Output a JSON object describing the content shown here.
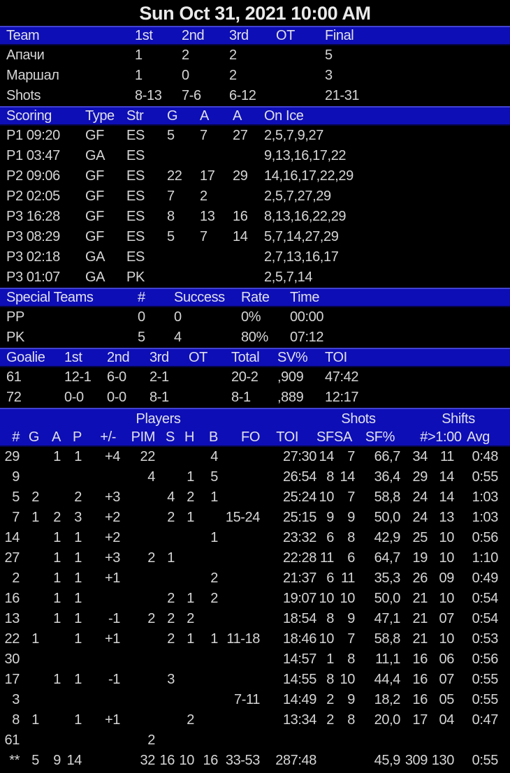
{
  "title": "Sun Oct 31, 2021 10:00 AM",
  "colors": {
    "background": "#000000",
    "header_bar": "#0e0eb6",
    "header_edge_light": "#4242d2",
    "header_edge_dark": "#050548",
    "text": "#d5d5d5",
    "header_text": "#dfe0ec"
  },
  "team_table": {
    "headers": [
      "Team",
      "1st",
      "2nd",
      "3rd",
      "OT",
      "Final"
    ],
    "rows": [
      [
        "Апачи",
        "1",
        "2",
        "2",
        "",
        "5"
      ],
      [
        "Маршал",
        "1",
        "0",
        "2",
        "",
        "3"
      ],
      [
        "Shots",
        "8-13",
        "7-6",
        "6-12",
        "",
        "21-31"
      ]
    ]
  },
  "scoring_table": {
    "headers": [
      "Scoring",
      "Type",
      "Str",
      "G",
      "A",
      "A",
      "On Ice"
    ],
    "rows": [
      [
        "P1 09:20",
        "GF",
        "ES",
        "5",
        "7",
        "27",
        "2,5,7,9,27"
      ],
      [
        "P1 03:47",
        "GA",
        "ES",
        "",
        "",
        "",
        "9,13,16,17,22"
      ],
      [
        "P2 09:06",
        "GF",
        "ES",
        "22",
        "17",
        "29",
        "14,16,17,22,29"
      ],
      [
        "P2 02:05",
        "GF",
        "ES",
        "7",
        "2",
        "",
        "2,5,7,27,29"
      ],
      [
        "P3 16:28",
        "GF",
        "ES",
        "8",
        "13",
        "16",
        "8,13,16,22,29"
      ],
      [
        "P3 08:29",
        "GF",
        "ES",
        "5",
        "7",
        "14",
        "5,7,14,27,29"
      ],
      [
        "P3 02:18",
        "GA",
        "ES",
        "",
        "",
        "",
        "2,7,13,16,17"
      ],
      [
        "P3 01:07",
        "GA",
        "PK",
        "",
        "",
        "",
        "2,5,7,14"
      ]
    ]
  },
  "special_teams_table": {
    "headers": [
      "Special Teams",
      "#",
      "Success",
      "Rate",
      "Time"
    ],
    "rows": [
      [
        "PP",
        "0",
        "0",
        "0%",
        "00:00"
      ],
      [
        "PK",
        "5",
        "4",
        "80%",
        "07:12"
      ]
    ]
  },
  "goalie_table": {
    "headers": [
      "Goalie",
      "1st",
      "2nd",
      "3rd",
      "OT",
      "Total",
      "SV%",
      "TOI"
    ],
    "rows": [
      [
        "61",
        "12-1",
        "6-0",
        "2-1",
        "",
        "20-2",
        ",909",
        "47:42"
      ],
      [
        "72",
        "0-0",
        "0-0",
        "8-1",
        "",
        "8-1",
        ",889",
        "12:17"
      ]
    ]
  },
  "players_table": {
    "groups": {
      "players": "Players",
      "shots": "Shots",
      "shifts": "Shifts"
    },
    "headers": [
      "#",
      "G",
      "A",
      "P",
      "+/-",
      "PIM",
      "S",
      "H",
      "B",
      "FO",
      "TOI",
      "SF",
      "SA",
      "SF%",
      "#",
      ">1:00",
      "Avg"
    ],
    "rows": [
      [
        "29",
        "",
        "1",
        "1",
        "+4",
        "22",
        "",
        "",
        "4",
        "",
        "27:30",
        "14",
        "7",
        "66,7",
        "34",
        "11",
        "0:48"
      ],
      [
        "9",
        "",
        "",
        "",
        "",
        "4",
        "",
        "1",
        "5",
        "",
        "26:54",
        "8",
        "14",
        "36,4",
        "29",
        "14",
        "0:55"
      ],
      [
        "5",
        "2",
        "",
        "2",
        "+3",
        "",
        "4",
        "2",
        "1",
        "",
        "25:24",
        "10",
        "7",
        "58,8",
        "24",
        "14",
        "1:03"
      ],
      [
        "7",
        "1",
        "2",
        "3",
        "+2",
        "",
        "2",
        "1",
        "",
        "15-24",
        "25:15",
        "9",
        "9",
        "50,0",
        "24",
        "13",
        "1:03"
      ],
      [
        "14",
        "",
        "1",
        "1",
        "+2",
        "",
        "",
        "",
        "1",
        "",
        "23:32",
        "6",
        "8",
        "42,9",
        "25",
        "10",
        "0:56"
      ],
      [
        "27",
        "",
        "1",
        "1",
        "+3",
        "2",
        "1",
        "",
        "",
        "",
        "22:28",
        "11",
        "6",
        "64,7",
        "19",
        "10",
        "1:10"
      ],
      [
        "2",
        "",
        "1",
        "1",
        "+1",
        "",
        "",
        "",
        "2",
        "",
        "21:37",
        "6",
        "11",
        "35,3",
        "26",
        "09",
        "0:49"
      ],
      [
        "16",
        "",
        "1",
        "1",
        "",
        "",
        "2",
        "1",
        "2",
        "",
        "19:07",
        "10",
        "10",
        "50,0",
        "21",
        "10",
        "0:54"
      ],
      [
        "13",
        "",
        "1",
        "1",
        "-1",
        "2",
        "2",
        "2",
        "",
        "",
        "18:54",
        "8",
        "9",
        "47,1",
        "21",
        "07",
        "0:54"
      ],
      [
        "22",
        "1",
        "",
        "1",
        "+1",
        "",
        "2",
        "1",
        "1",
        "11-18",
        "18:46",
        "10",
        "7",
        "58,8",
        "21",
        "10",
        "0:53"
      ],
      [
        "30",
        "",
        "",
        "",
        "",
        "",
        "",
        "",
        "",
        "",
        "14:57",
        "1",
        "8",
        "11,1",
        "16",
        "06",
        "0:56"
      ],
      [
        "17",
        "",
        "1",
        "1",
        "-1",
        "",
        "3",
        "",
        "",
        "",
        "14:55",
        "8",
        "10",
        "44,4",
        "16",
        "07",
        "0:55"
      ],
      [
        "3",
        "",
        "",
        "",
        "",
        "",
        "",
        "",
        "",
        "7-11",
        "14:49",
        "2",
        "9",
        "18,2",
        "16",
        "05",
        "0:55"
      ],
      [
        "8",
        "1",
        "",
        "1",
        "+1",
        "",
        "",
        "2",
        "",
        "",
        "13:34",
        "2",
        "8",
        "20,0",
        "17",
        "04",
        "0:47"
      ],
      [
        "61",
        "",
        "",
        "",
        "",
        "2",
        "",
        "",
        "",
        "",
        "",
        "",
        "",
        "",
        "",
        "",
        ""
      ],
      [
        "**",
        "5",
        "9",
        "14",
        "",
        "32",
        "16",
        "10",
        "16",
        "33-53",
        "287:48",
        "",
        "",
        "45,9",
        "309",
        "130",
        "0:55"
      ]
    ]
  }
}
